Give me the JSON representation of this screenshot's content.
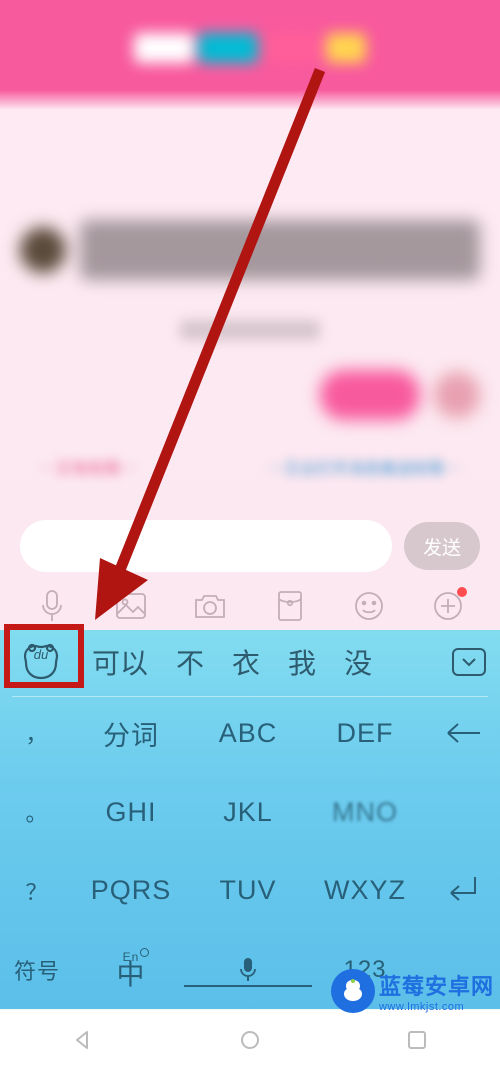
{
  "chat": {
    "send_label": "发送",
    "tip_left": "⋯又有权限⋯",
    "tip_mid": "⋯又云打开消息推送权限⋯"
  },
  "toolbar": {
    "icons": [
      "voice-icon",
      "image-icon",
      "camera-icon",
      "redpacket-icon",
      "emoji-icon",
      "add-icon"
    ]
  },
  "keyboard": {
    "logo_text": "du",
    "candidates": [
      "可以",
      "不",
      "衣",
      "我",
      "没"
    ],
    "side": [
      "，",
      "。",
      "？",
      "！"
    ],
    "rows": [
      [
        "分词",
        "ABC",
        "DEF"
      ],
      [
        "GHI",
        "JKL",
        "MNO"
      ],
      [
        "PQRS",
        "TUV",
        "WXYZ"
      ]
    ],
    "symbol_label": "符号",
    "lang_sup": "En",
    "lang_main": "中",
    "num_label": "123"
  },
  "watermark": {
    "text": "蓝莓安卓网",
    "url": "www.lmkjst.com"
  },
  "colors": {
    "accent_pink": "#f85a9e",
    "kbd_top": "#82dcf0",
    "kbd_text": "#286079",
    "highlight_red": "#c51917"
  }
}
